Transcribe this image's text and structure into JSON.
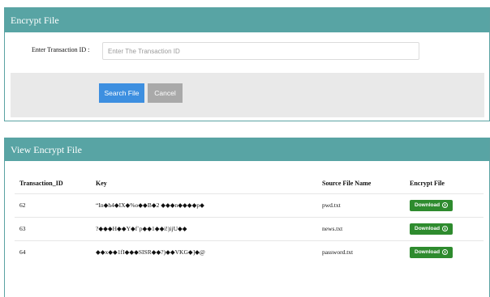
{
  "encrypt_panel": {
    "title": "Encrypt File",
    "label": "Enter Transaction ID :",
    "placeholder": "Enter The Transaction ID",
    "value": "",
    "search_label": "Search File",
    "cancel_label": "Cancel"
  },
  "view_panel": {
    "title": "View Encrypt File",
    "columns": [
      "Transaction_ID",
      "Key",
      "Source File Name",
      "Encrypt File"
    ],
    "rows": [
      {
        "id": "62",
        "key": "“In◆h4◆IX◆%o◆◆B◆2 ◆◆◆n◆◆◆◆p◆",
        "file": "pwd.txt",
        "action": "Download"
      },
      {
        "id": "63",
        "key": "?◆◆◆H◆◆Y◆f`p◆◆1◆◆i!)ijU◆◆",
        "file": "news.txt",
        "action": "Download"
      },
      {
        "id": "64",
        "key": "◆◆x◆◆1fI◆◆◆SISR◆◆?)◆◆VKG◆]◆@",
        "file": "password.txt",
        "action": "Download"
      }
    ]
  },
  "colors": {
    "header": "#58a4a4",
    "primary": "#3d8fe0",
    "cancel": "#a9a9a9",
    "download": "#2e8b2e"
  },
  "icons": {
    "download": "download-icon"
  }
}
